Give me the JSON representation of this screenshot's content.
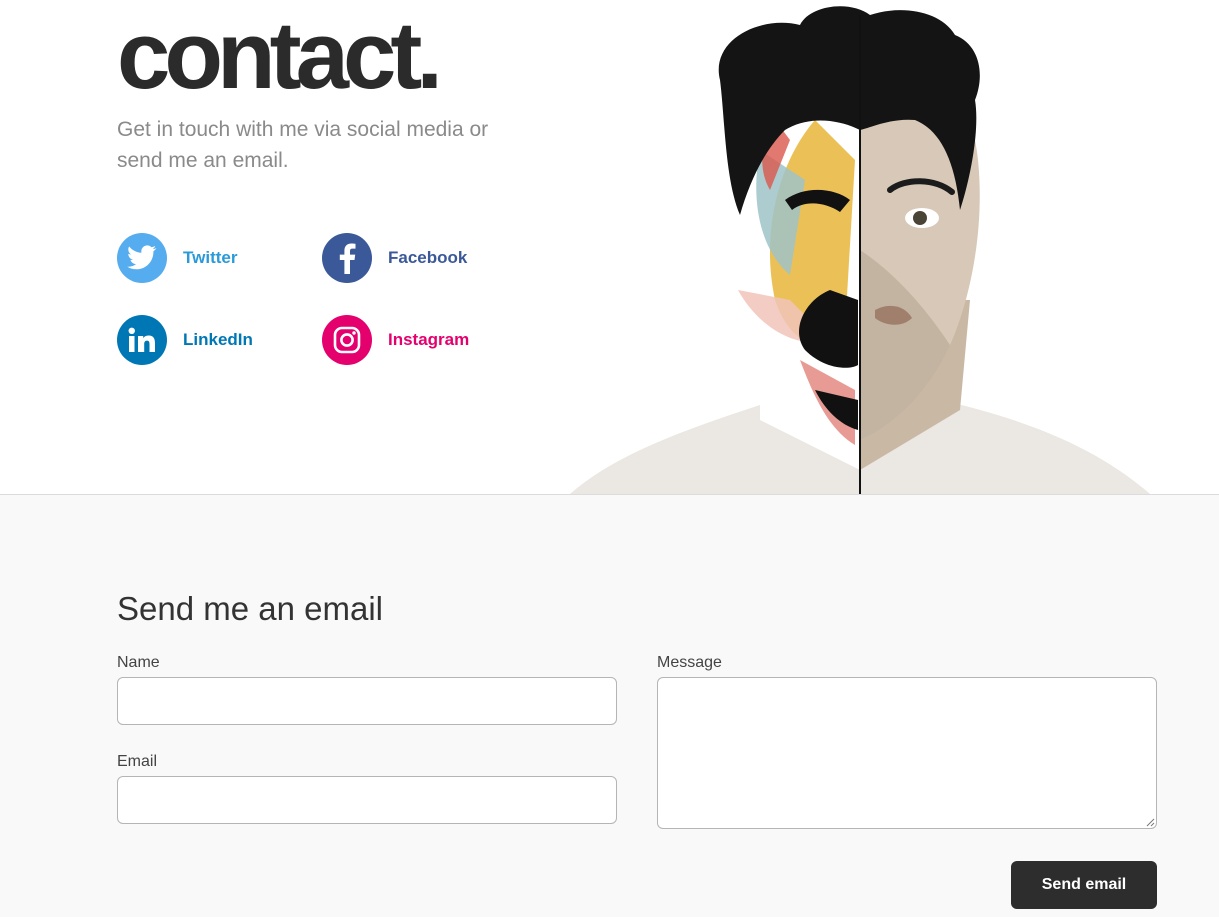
{
  "header": {
    "title": "contact.",
    "subtitle": "Get in touch with me via social media or send me an email."
  },
  "social": {
    "twitter": {
      "label": "Twitter",
      "icon": "twitter-bird-icon",
      "color": "#55acee"
    },
    "facebook": {
      "label": "Facebook",
      "icon": "facebook-f-icon",
      "color": "#3b5998"
    },
    "linkedin": {
      "label": "LinkedIn",
      "icon": "linkedin-in-icon",
      "color": "#0077b5"
    },
    "instagram": {
      "label": "Instagram",
      "icon": "instagram-camera-icon",
      "color": "#e4006d"
    }
  },
  "form": {
    "title": "Send me an email",
    "name_label": "Name",
    "name_value": "",
    "email_label": "Email",
    "email_value": "",
    "message_label": "Message",
    "message_value": "",
    "submit_label": "Send email"
  }
}
